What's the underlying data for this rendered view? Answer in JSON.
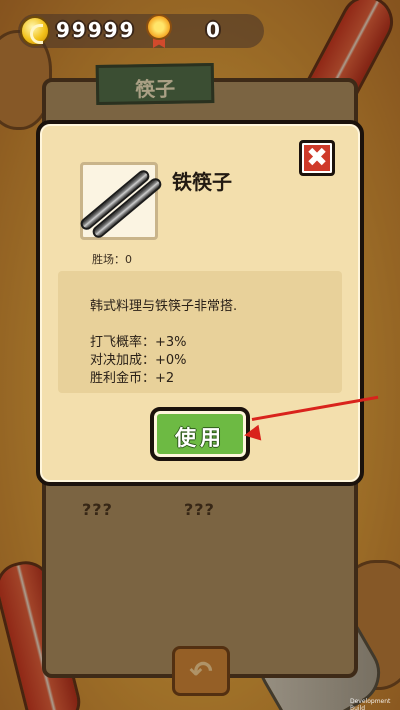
{
  "currency": {
    "coins": "99999",
    "medals": "0"
  },
  "background": {
    "panel_title": "筷子",
    "unknown_slot_1": "???",
    "unknown_slot_2": "???",
    "back_icon": "back-arrow-icon"
  },
  "dialog": {
    "item_name": "铁筷子",
    "wins_label": "胜场：",
    "wins_value": "0",
    "description": "韩式料理与铁筷子非常搭.",
    "stats": [
      {
        "label": "打飞概率：",
        "value": "+3%"
      },
      {
        "label": "对决加成：",
        "value": "+0%"
      },
      {
        "label": "胜利金币：",
        "value": "+2"
      }
    ],
    "use_button": "使用",
    "close_icon": "close-icon"
  },
  "footer": {
    "build_text": "Development Build"
  },
  "colors": {
    "use_button": "#6dba43",
    "close_button": "#cf3a2a",
    "dialog_bg": "#f3dfad",
    "annotation_arrow": "#d9231c"
  }
}
